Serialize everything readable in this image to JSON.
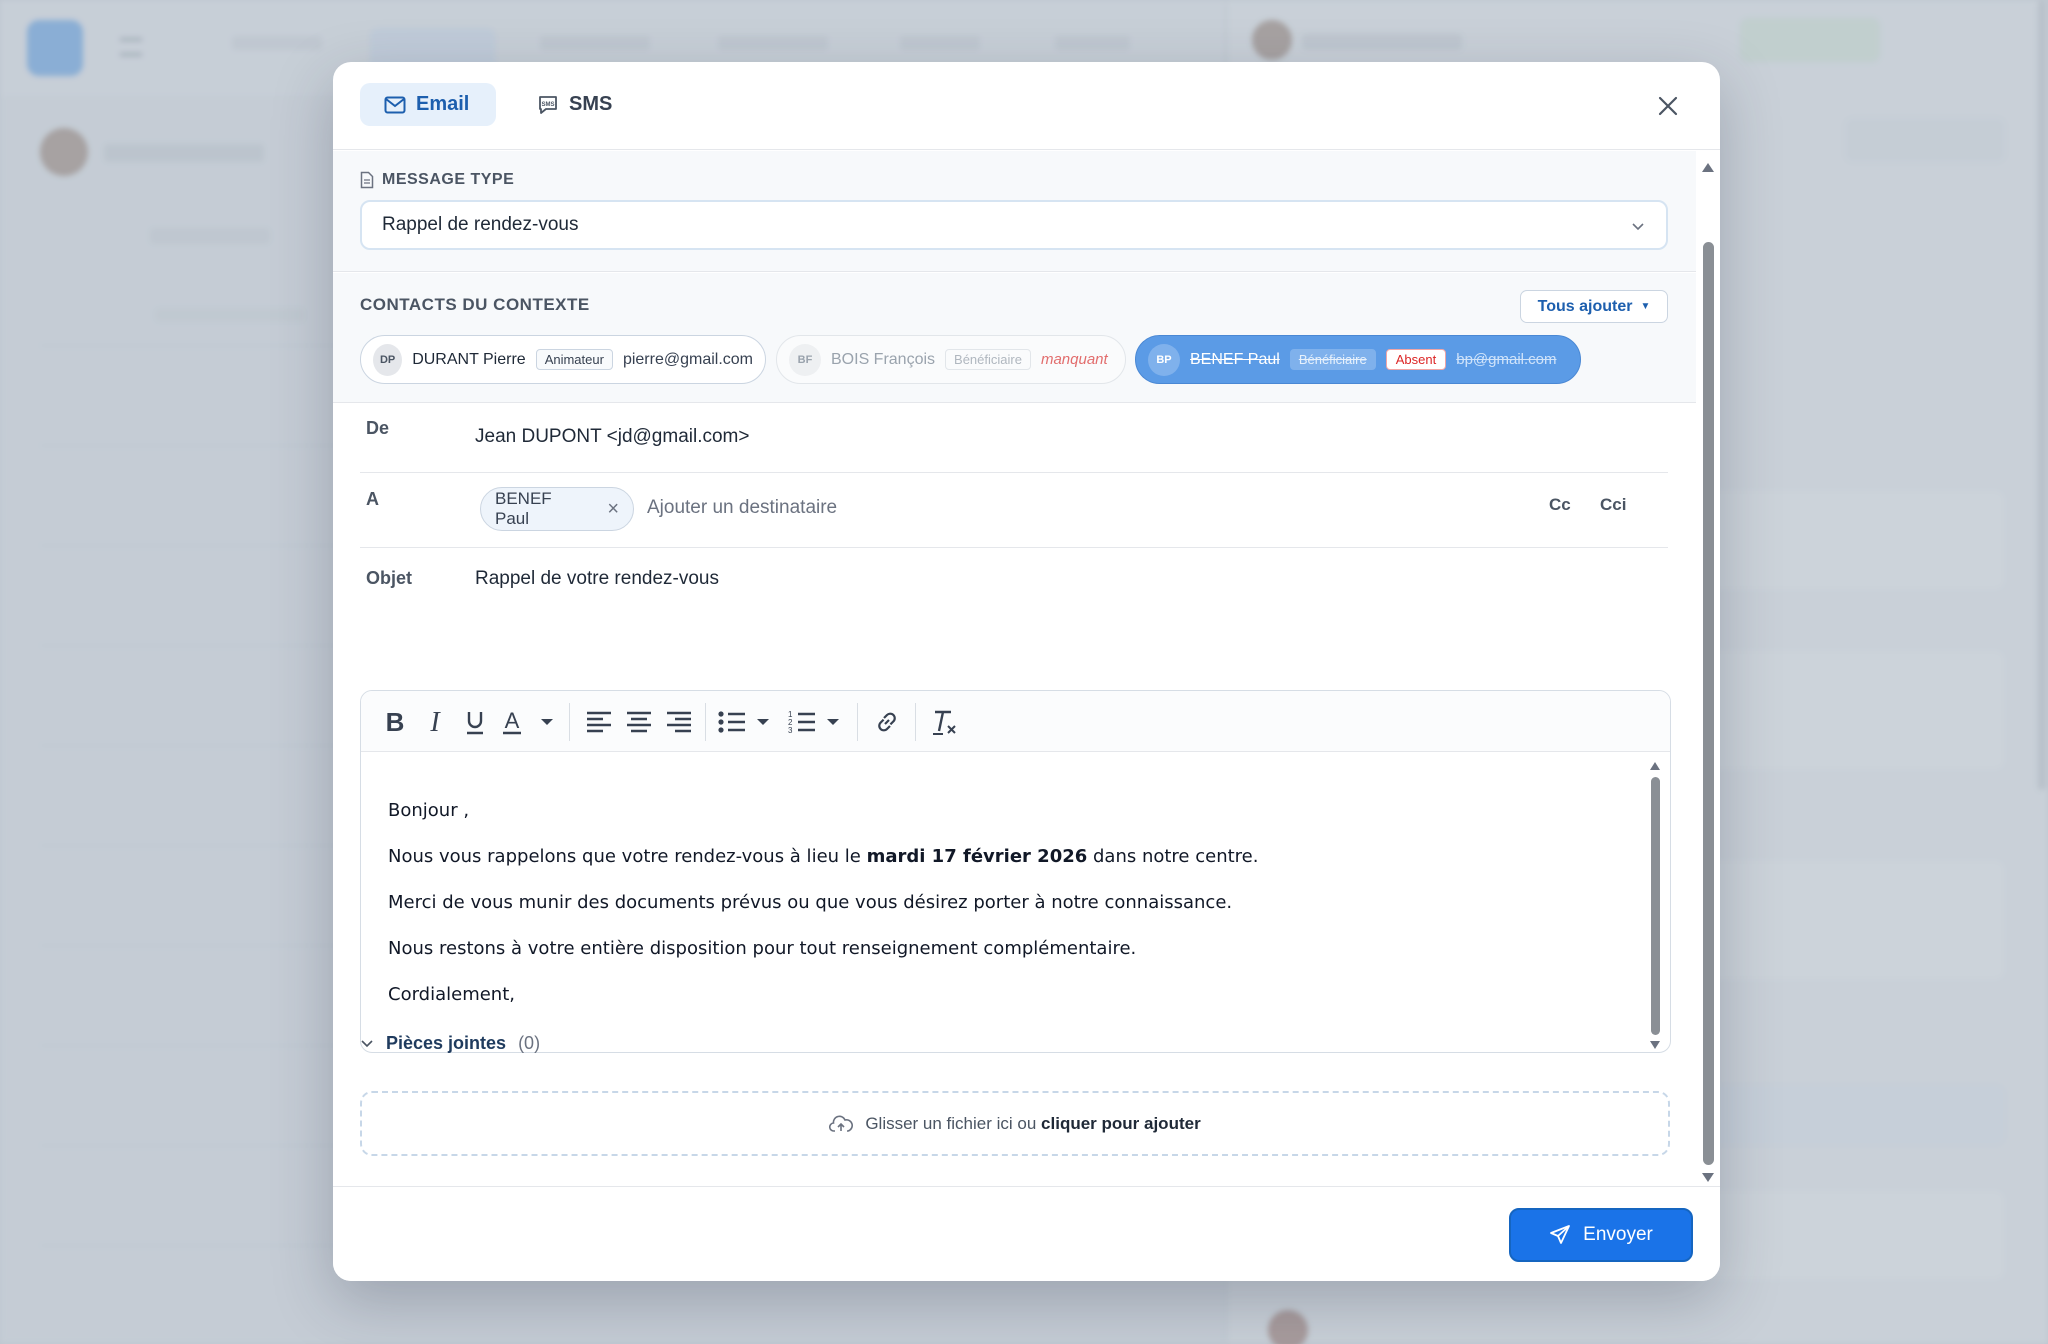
{
  "tabs": {
    "email": "Email",
    "sms": "SMS"
  },
  "message_type": {
    "label": "MESSAGE TYPE",
    "selected": "Rappel de rendez-vous"
  },
  "contacts": {
    "label": "CONTACTS DU CONTEXTE",
    "add_all": "Tous ajouter",
    "items": [
      {
        "initials": "DP",
        "name": "DURANT Pierre",
        "role": "Animateur",
        "email": "pierre@gmail.com"
      },
      {
        "initials": "BF",
        "name": "BOIS François",
        "role": "Bénéficiaire",
        "status": "manquant"
      },
      {
        "initials": "BP",
        "name": "BENEF Paul",
        "role": "Bénéficiaire",
        "status": "Absent",
        "email": "bp@gmail.com"
      }
    ]
  },
  "from": {
    "label": "De",
    "value": "Jean DUPONT <jd@gmail.com>"
  },
  "to": {
    "label": "A",
    "recipient": "BENEF Paul",
    "placeholder": "Ajouter un destinataire",
    "cc": "Cc",
    "bcc": "Cci"
  },
  "subject": {
    "label": "Objet",
    "value": "Rappel de votre rendez-vous"
  },
  "body": {
    "greeting": "Bonjour ,",
    "line1_pre": "Nous vous rappelons que votre rendez-vous à lieu le ",
    "line1_bold": "mardi 17 février 2026",
    "line1_post": " dans notre centre.",
    "line2": "Merci de vous munir des documents prévus ou que vous désirez porter à notre connaissance.",
    "line3": "Nous restons à votre entière disposition pour tout renseignement complémentaire.",
    "closing": "Cordialement,"
  },
  "attachments": {
    "label": "Pièces jointes",
    "count": "(0)",
    "drop_text": "Glisser un fichier ici ou ",
    "drop_link": "cliquer pour ajouter"
  },
  "send_label": "Envoyer",
  "colors": {
    "primary": "#1a73e8",
    "accent_chip": "#5b9be6",
    "danger": "#dc2626"
  }
}
